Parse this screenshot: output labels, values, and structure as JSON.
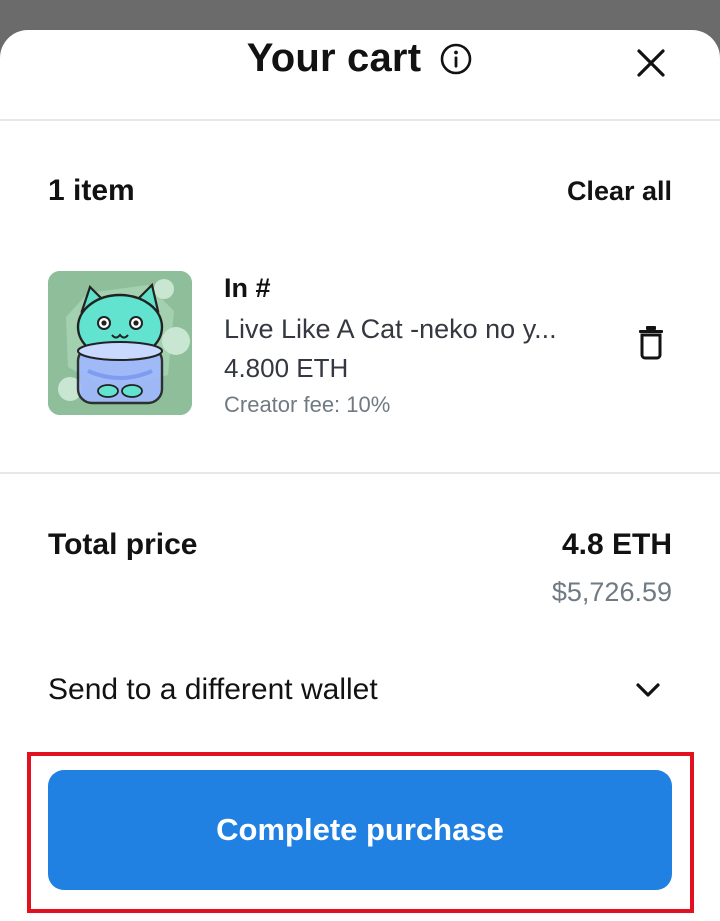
{
  "header": {
    "title": "Your cart",
    "info_icon": "info-icon",
    "close_icon": "close-icon"
  },
  "cart": {
    "item_count": "1 item",
    "clear_all_label": "Clear all",
    "items": [
      {
        "collection": "In #",
        "name": "Live Like A Cat -neko no y...",
        "price": "4.800 ETH",
        "creator_fee": "Creator fee: 10%",
        "delete_icon": "trash-icon"
      }
    ]
  },
  "summary": {
    "total_label": "Total price",
    "total_eth": "4.8 ETH",
    "total_usd": "$5,726.59"
  },
  "wallet": {
    "label": "Send to a different wallet",
    "chevron_icon": "chevron-down-icon"
  },
  "actions": {
    "purchase_label": "Complete purchase"
  },
  "colors": {
    "accent": "#2081e2",
    "highlight": "#e3111f",
    "overlay": "#6b6b6b"
  }
}
